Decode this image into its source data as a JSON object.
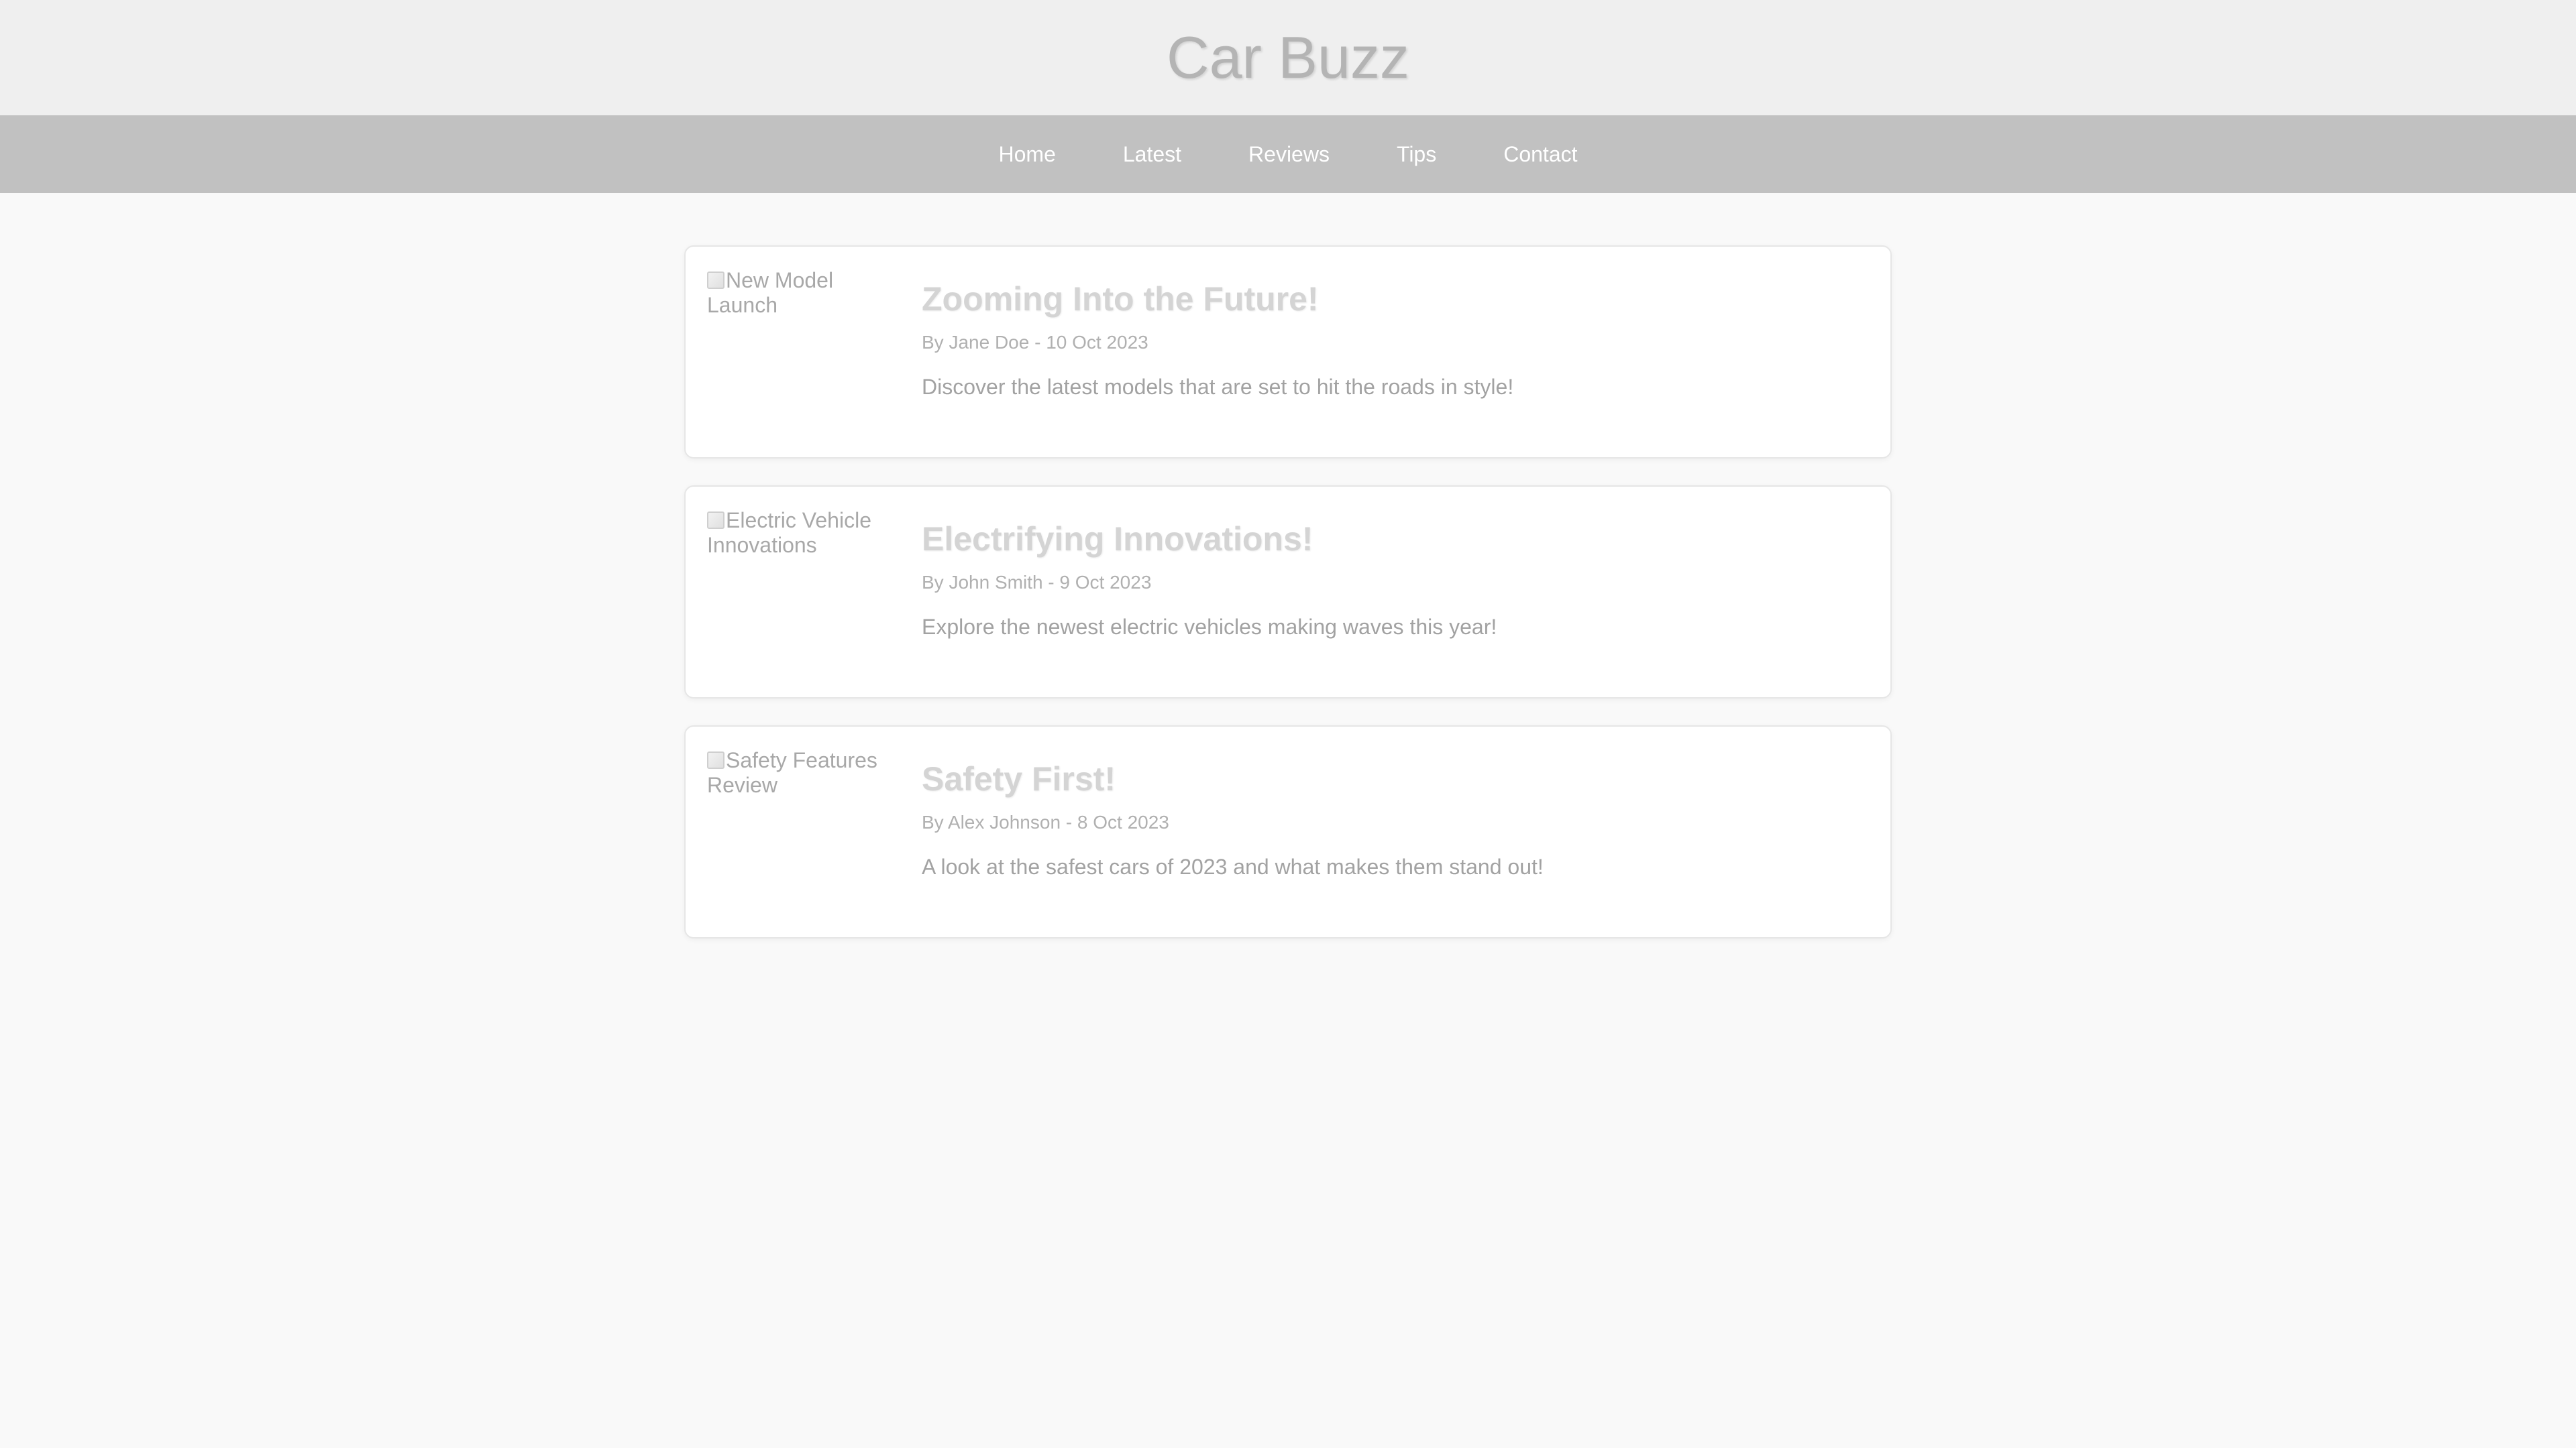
{
  "site": {
    "title": "Car Buzz"
  },
  "nav": {
    "items": [
      {
        "label": "Home"
      },
      {
        "label": "Latest"
      },
      {
        "label": "Reviews"
      },
      {
        "label": "Tips"
      },
      {
        "label": "Contact"
      }
    ]
  },
  "articles": [
    {
      "image_alt": "New Model Launch",
      "title": "Zooming Into the Future!",
      "meta": "By Jane Doe - 10 Oct 2023",
      "excerpt": "Discover the latest models that are set to hit the roads in style!"
    },
    {
      "image_alt": "Electric Vehicle Innovations",
      "title": "Electrifying Innovations!",
      "meta": "By John Smith - 9 Oct 2023",
      "excerpt": "Explore the newest electric vehicles making waves this year!"
    },
    {
      "image_alt": "Safety Features Review",
      "title": "Safety First!",
      "meta": "By Alex Johnson - 8 Oct 2023",
      "excerpt": "A look at the safest cars of 2023 and what makes them stand out!"
    }
  ],
  "colors": {
    "header_bg": "#efefef",
    "nav_bg": "#c1c1c1",
    "page_bg": "#f9f9f9",
    "card_bg": "#ffffff"
  }
}
